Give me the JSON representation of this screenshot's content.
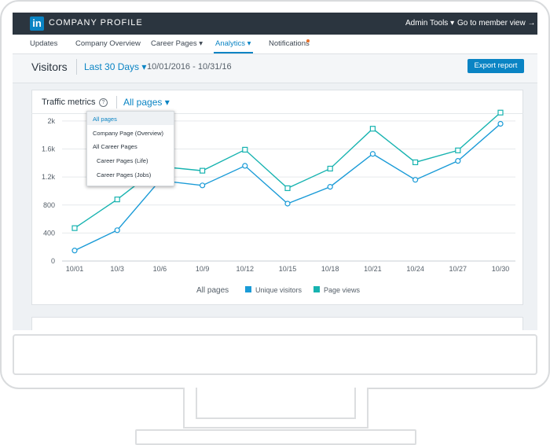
{
  "header": {
    "logo_text": "in",
    "brand": "COMPANY PROFILE",
    "admin_tools": "Admin Tools ▾",
    "member_view": "Go to member view →"
  },
  "nav": {
    "items": [
      "Updates",
      "Company Overview",
      "Career Pages ▾",
      "Analytics ▾",
      "Notifications"
    ],
    "active_index": 3
  },
  "visitors": {
    "title": "Visitors",
    "range": "Last 30 Days ▾",
    "dates": "10/01/2016 - 10/31/16",
    "export": "Export report"
  },
  "card": {
    "title": "Traffic metrics",
    "help_icon": "?",
    "filter": "All pages ▾"
  },
  "dropdown": {
    "options": [
      "All pages",
      "Company Page (Overview)",
      "All Career Pages",
      "Career Pages (Life)",
      "Career Pages (Jobs)"
    ],
    "selected_index": 0
  },
  "colors": {
    "accent": "#0a84c4",
    "series_unique": "#1a9bd7",
    "series_views": "#17b3b0",
    "topbar": "#2b353f"
  },
  "chart_data": {
    "type": "line",
    "categories": [
      "10/01",
      "10/3",
      "10/6",
      "10/9",
      "10/12",
      "10/15",
      "10/18",
      "10/21",
      "10/24",
      "10/27",
      "10/30"
    ],
    "yticks": [
      "0",
      "400",
      "800",
      "1.2k",
      "1.6k",
      "2k"
    ],
    "ylim": [
      0,
      2100
    ],
    "grid": true,
    "legend_label": "All pages",
    "legend_position": "bottom",
    "series": [
      {
        "name": "Unique visitors",
        "marker": "circle",
        "color": "#1a9bd7",
        "values": [
          150,
          440,
          1150,
          1080,
          1360,
          820,
          1060,
          1530,
          1160,
          1430,
          1960
        ]
      },
      {
        "name": "Page views",
        "marker": "square",
        "color": "#17b3b0",
        "values": [
          470,
          880,
          1350,
          1290,
          1590,
          1040,
          1320,
          1890,
          1410,
          1580,
          2120
        ]
      }
    ]
  }
}
